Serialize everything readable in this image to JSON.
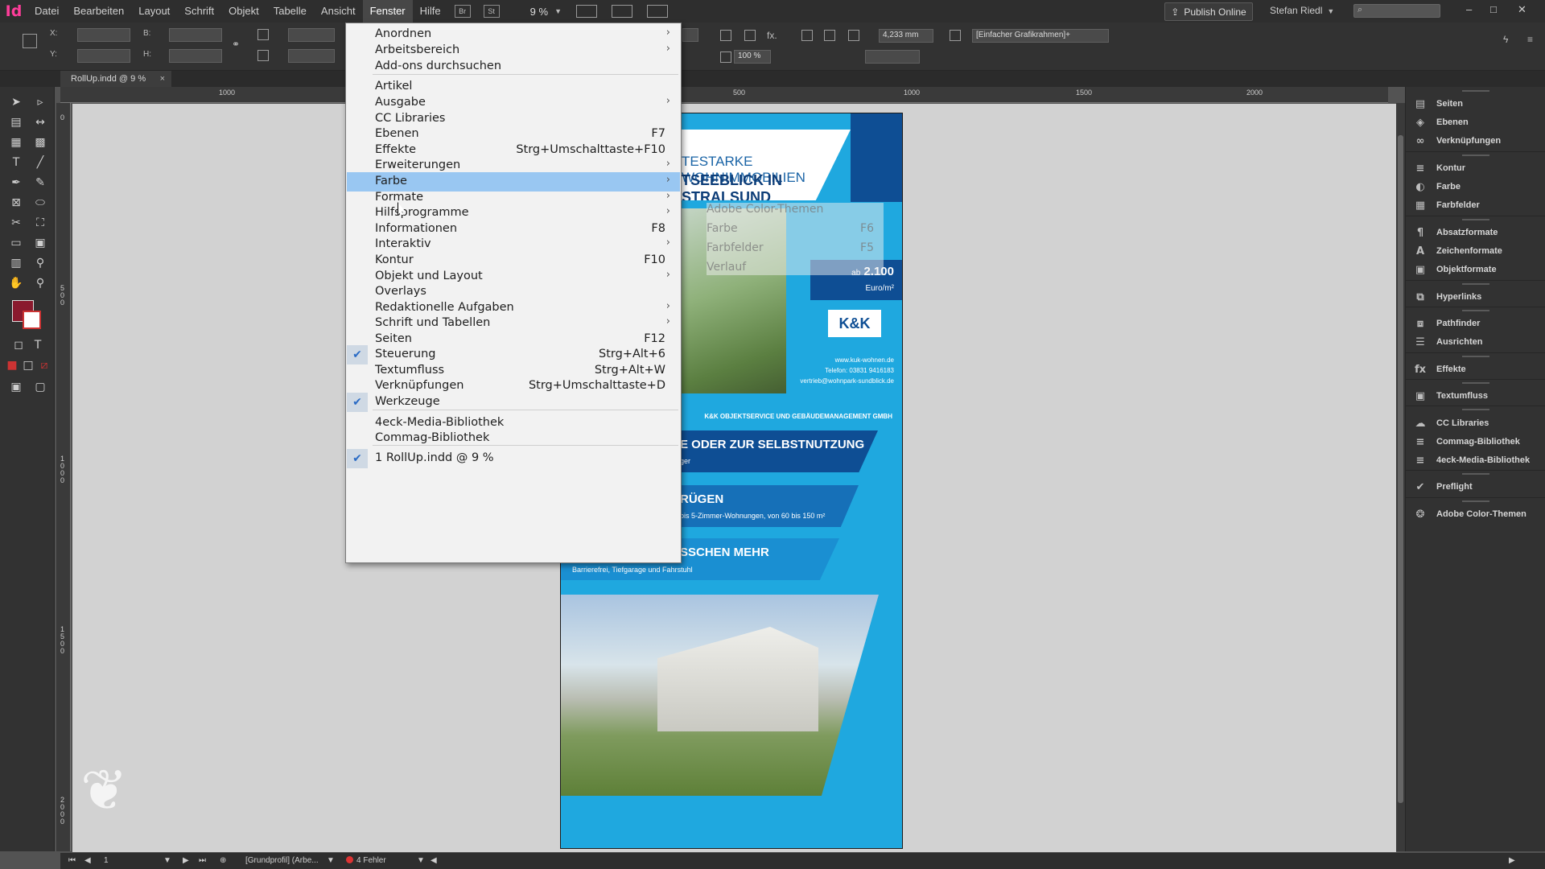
{
  "app": {
    "logo": "Id",
    "menus": [
      "Datei",
      "Bearbeiten",
      "Layout",
      "Schrift",
      "Objekt",
      "Tabelle",
      "Ansicht",
      "Fenster",
      "Hilfe"
    ],
    "active_menu": "Fenster",
    "bridge_label": "Br",
    "stock_label": "St",
    "zoom": "9 %",
    "publish_label": "Publish Online",
    "user": "Stefan Riedl",
    "win_min": "–",
    "win_max": "□",
    "win_close": "✕"
  },
  "control_panel": {
    "x_label": "X:",
    "y_label": "Y:",
    "w_label": "B:",
    "h_label": "H:",
    "stroke_weight": "4,233 mm",
    "scale_percent": "100 %",
    "frame_style": "[Einfacher Grafikrahmen]+"
  },
  "document": {
    "tab_title": "RollUp.indd @ 9 %",
    "tab_close": "×",
    "ruler_h": [
      "1000",
      "500",
      "1000",
      "1500",
      "2000"
    ],
    "ruler_v": [
      "0",
      "500",
      "1000",
      "1500",
      "2000"
    ],
    "headline_1": "TESTARKE WOHNIMMOBILIEN",
    "headline_2": "TSEEBLICK IN STRALSUND",
    "price": "2.100",
    "price_prefix": "ab",
    "price_unit": "Euro/m²",
    "kk_logo": "K&K",
    "kk_web": "www.kuk-wohnen.de",
    "kk_phone": "Telefon: 03831 9416183",
    "kk_mail": "vertrieb@wohnpark-sundblick.de",
    "kk_company": "K&K OBJEKTSERVICE UND GEBÄUDEMANAGEMENT GMBH",
    "band1_title": "E ODER ZUR SELBSTNUTZUNG",
    "band1_sub": "ger",
    "band2_title": "RÜGEN",
    "band2_sub": "bis 5-Zimmer-Wohnungen, von 60 bis 150 m²",
    "band3_title": "SSCHEN MEHR",
    "band3_sub": "Barrierefrei, Tiefgarage und Fahrstuhl"
  },
  "dropdown": {
    "items": [
      {
        "label": "Anordnen",
        "shortcut": "",
        "submenu": true,
        "checked": false
      },
      {
        "label": "Arbeitsbereich",
        "shortcut": "",
        "submenu": true,
        "checked": false
      },
      {
        "label": "Add-ons durchsuchen",
        "shortcut": "",
        "submenu": false,
        "checked": false
      },
      {
        "label": "Artikel",
        "shortcut": "",
        "submenu": false,
        "checked": false
      },
      {
        "label": "Ausgabe",
        "shortcut": "",
        "submenu": true,
        "checked": false
      },
      {
        "label": "CC Libraries",
        "shortcut": "",
        "submenu": false,
        "checked": false
      },
      {
        "label": "Ebenen",
        "shortcut": "F7",
        "submenu": false,
        "checked": false
      },
      {
        "label": "Effekte",
        "shortcut": "Strg+Umschalttaste+F10",
        "submenu": false,
        "checked": false
      },
      {
        "label": "Erweiterungen",
        "shortcut": "",
        "submenu": true,
        "checked": false
      },
      {
        "label": "Farbe",
        "shortcut": "",
        "submenu": true,
        "checked": false,
        "highlighted": true
      },
      {
        "label": "Formate",
        "shortcut": "",
        "submenu": true,
        "checked": false
      },
      {
        "label": "Hilfsprogramme",
        "shortcut": "",
        "submenu": true,
        "checked": false
      },
      {
        "label": "Informationen",
        "shortcut": "F8",
        "submenu": false,
        "checked": false
      },
      {
        "label": "Interaktiv",
        "shortcut": "",
        "submenu": true,
        "checked": false
      },
      {
        "label": "Kontur",
        "shortcut": "F10",
        "submenu": false,
        "checked": false
      },
      {
        "label": "Objekt und Layout",
        "shortcut": "",
        "submenu": true,
        "checked": false
      },
      {
        "label": "Overlays",
        "shortcut": "",
        "submenu": false,
        "checked": false
      },
      {
        "label": "Redaktionelle Aufgaben",
        "shortcut": "",
        "submenu": true,
        "checked": false
      },
      {
        "label": "Schrift und Tabellen",
        "shortcut": "",
        "submenu": true,
        "checked": false
      },
      {
        "label": "Seiten",
        "shortcut": "F12",
        "submenu": false,
        "checked": false
      },
      {
        "label": "Steuerung",
        "shortcut": "Strg+Alt+6",
        "submenu": false,
        "checked": true
      },
      {
        "label": "Textumfluss",
        "shortcut": "Strg+Alt+W",
        "submenu": false,
        "checked": false
      },
      {
        "label": "Verknüpfungen",
        "shortcut": "Strg+Umschalttaste+D",
        "submenu": false,
        "checked": false
      },
      {
        "label": "Werkzeuge",
        "shortcut": "",
        "submenu": false,
        "checked": true
      },
      {
        "label": "4eck-Media-Bibliothek",
        "shortcut": "",
        "submenu": false,
        "checked": false
      },
      {
        "label": "Commag-Bibliothek",
        "shortcut": "",
        "submenu": false,
        "checked": false
      },
      {
        "label": "1 RollUp.indd @ 9 %",
        "shortcut": "",
        "submenu": false,
        "checked": true
      }
    ],
    "arrow_glyph": "›",
    "check_glyph": "✔",
    "submenu_ghost": [
      {
        "label": "Adobe Color-Themen",
        "shortcut": ""
      },
      {
        "label": "Farbe",
        "shortcut": "F6"
      },
      {
        "label": "Farbfelder",
        "shortcut": "F5"
      },
      {
        "label": "Verlauf",
        "shortcut": ""
      }
    ]
  },
  "panels": [
    {
      "label": "Seiten",
      "icon": "pages-icon",
      "glyph": "▤"
    },
    {
      "label": "Ebenen",
      "icon": "layers-icon",
      "glyph": "◈"
    },
    {
      "label": "Verknüpfungen",
      "icon": "links-icon",
      "glyph": "∞"
    },
    {
      "label": "Kontur",
      "icon": "stroke-icon",
      "glyph": "≡"
    },
    {
      "label": "Farbe",
      "icon": "color-icon",
      "glyph": "◐"
    },
    {
      "label": "Farbfelder",
      "icon": "swatches-icon",
      "glyph": "▦"
    },
    {
      "label": "Absatzformate",
      "icon": "paragraph-styles-icon",
      "glyph": "¶"
    },
    {
      "label": "Zeichenformate",
      "icon": "character-styles-icon",
      "glyph": "A"
    },
    {
      "label": "Objektformate",
      "icon": "object-styles-icon",
      "glyph": "▣"
    },
    {
      "label": "Hyperlinks",
      "icon": "hyperlinks-icon",
      "glyph": "⧉"
    },
    {
      "label": "Pathfinder",
      "icon": "pathfinder-icon",
      "glyph": "⧈"
    },
    {
      "label": "Ausrichten",
      "icon": "align-icon",
      "glyph": "☰"
    },
    {
      "label": "Effekte",
      "icon": "effects-icon",
      "glyph": "fx"
    },
    {
      "label": "Textumfluss",
      "icon": "text-wrap-icon",
      "glyph": "▣"
    },
    {
      "label": "CC Libraries",
      "icon": "cc-libraries-icon",
      "glyph": "☁"
    },
    {
      "label": "Commag-Bibliothek",
      "icon": "library-icon",
      "glyph": "≡"
    },
    {
      "label": "4eck-Media-Bibliothek",
      "icon": "library-icon",
      "glyph": "≡"
    },
    {
      "label": "Preflight",
      "icon": "preflight-icon",
      "glyph": "✔"
    },
    {
      "label": "Adobe Color-Themen",
      "icon": "color-themes-icon",
      "glyph": "❂"
    }
  ],
  "status": {
    "page": "1",
    "profile": "[Grundprofil] (Arbe...",
    "errors": "4 Fehler"
  },
  "colors": {
    "fill_swatch": "#8a1a2e",
    "accent_blue": "#1fa8df",
    "dark_blue": "#0e4e94",
    "menu_highlight": "#99c7f2"
  }
}
